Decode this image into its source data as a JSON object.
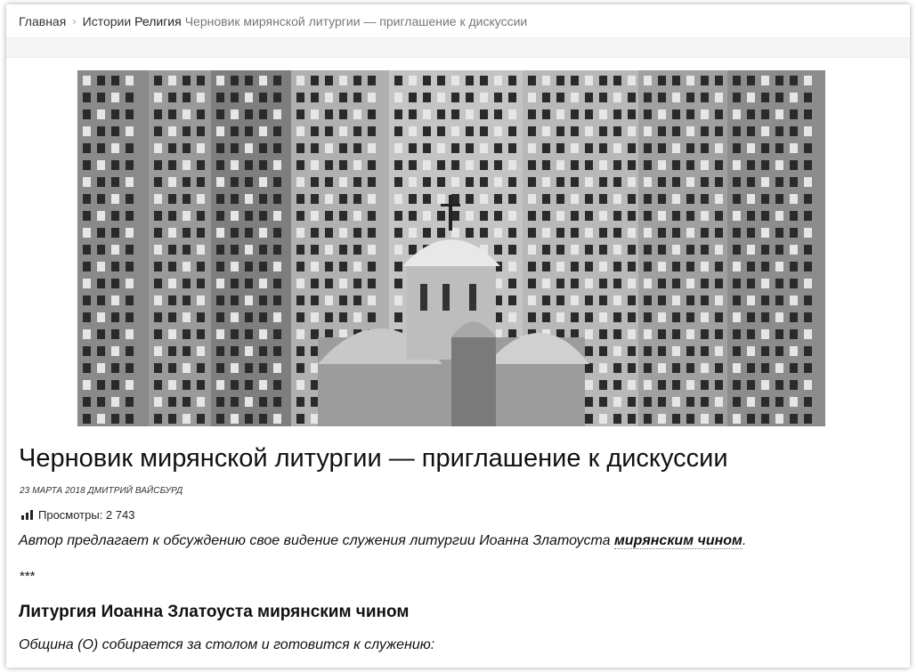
{
  "breadcrumb": {
    "home": "Главная",
    "section": "Истории",
    "category": "Религия",
    "current": "Черновик мирянской литургии — приглашение к дискуссии"
  },
  "hero": {
    "icon": "church-photo"
  },
  "article": {
    "title": "Черновик мирянской литургии — приглашение к дискуссии",
    "meta": "23 марта 2018 Дмитрий Вайсбурд",
    "views_label": "Просмотры: 2 743",
    "lead_before": "Автор предлагает к обсуждению свое видение служения литургии Иоанна Златоуста ",
    "lead_link": "мирянским чином",
    "lead_after": ".",
    "separator": "***",
    "subhead": "Литургия Иоанна Златоуста мирянским чином",
    "paragraph": "Община (О) собирается за столом и готовится к служению:"
  }
}
